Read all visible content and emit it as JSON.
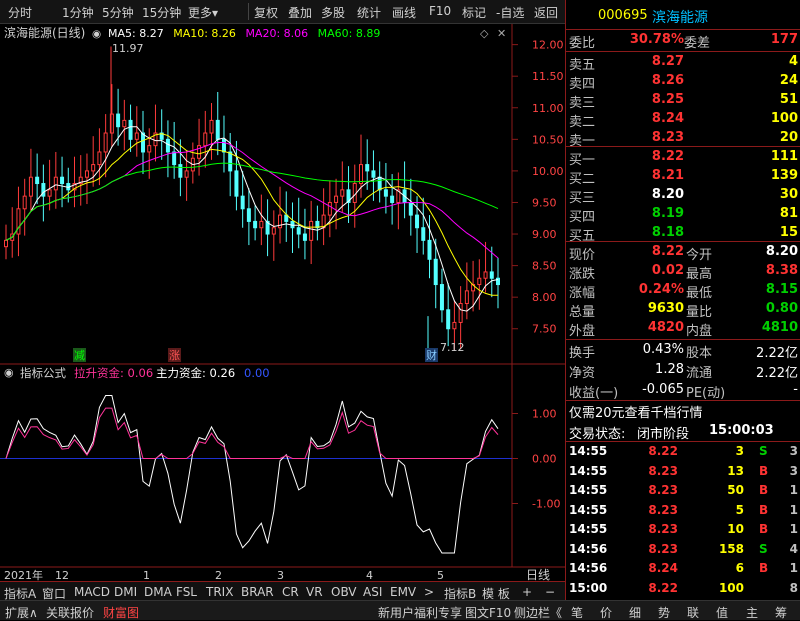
{
  "toolbar": {
    "left": [
      "分时",
      "1分钟",
      "5分钟",
      "15分钟",
      "更多"
    ],
    "more_arrow": "▾",
    "right": [
      "复权",
      "叠加",
      "多股",
      "统计",
      "画线",
      "F10",
      "标记",
      "-自选",
      "返回"
    ]
  },
  "chart": {
    "title": "滨海能源(日线)",
    "ma": [
      {
        "label": "MA5: 8.27",
        "color": "#ffffff"
      },
      {
        "label": "MA10: 8.26",
        "color": "#ffff00"
      },
      {
        "label": "MA20: 8.06",
        "color": "#ff00ff"
      },
      {
        "label": "MA60: 8.89",
        "color": "#00ff00"
      }
    ],
    "high_label": "11.97",
    "low_label": "7.12",
    "markers": {
      "jian": "减",
      "zhang": "涨",
      "cai": "财"
    },
    "ytick_labels": [
      "12.00",
      "11.50",
      "11.00",
      "10.50",
      "10.00",
      "9.50",
      "9.00",
      "8.50",
      "8.00",
      "7.50"
    ],
    "indicator": {
      "title": "指标公式",
      "s1": "拉升资金: 0.06",
      "s2": "主力资金: 0.26",
      "s3": "0.00",
      "ytick_labels": [
        "1.00",
        "0.00",
        "-1.00"
      ]
    },
    "date_labels": {
      "year": "2021年",
      "dec": "12",
      "jan": "1",
      "feb": "2",
      "mar": "3",
      "apr": "4",
      "may": "5"
    },
    "right_tab": "日线"
  },
  "chart_data": {
    "type": "candlestick",
    "title": "滨海能源(日线)",
    "ylim": [
      7.1,
      12.2
    ],
    "series": [
      {
        "name": "MA5",
        "color": "#ffffff"
      },
      {
        "name": "MA10",
        "color": "#ffff00"
      },
      {
        "name": "MA20",
        "color": "#ff00ff"
      },
      {
        "name": "MA60",
        "color": "#00ff00"
      }
    ],
    "close": [
      8.9,
      9.0,
      9.4,
      9.6,
      9.9,
      9.8,
      9.6,
      9.7,
      9.9,
      9.8,
      9.7,
      9.8,
      9.9,
      10.0,
      10.1,
      10.3,
      10.6,
      10.9,
      10.7,
      10.8,
      10.5,
      10.6,
      10.3,
      10.4,
      10.6,
      10.5,
      10.3,
      10.1,
      9.9,
      10.0,
      10.2,
      10.4,
      10.6,
      10.8,
      10.5,
      10.3,
      10.0,
      9.6,
      9.4,
      9.2,
      9.1,
      9.2,
      9.0,
      9.1,
      9.3,
      9.2,
      9.1,
      9.0,
      8.9,
      9.2,
      9.1,
      9.3,
      9.5,
      9.6,
      9.7,
      9.5,
      9.8,
      10.1,
      10.0,
      9.9,
      9.7,
      9.6,
      9.5,
      9.7,
      9.5,
      9.3,
      9.1,
      8.9,
      8.6,
      8.2,
      7.8,
      7.5,
      7.6,
      7.9,
      8.1,
      8.2,
      8.3,
      8.4,
      8.3,
      8.2
    ],
    "indicator": {
      "series": [
        {
          "name": "拉升资金",
          "last": 0.06
        },
        {
          "name": "主力资金",
          "last": 0.26
        }
      ],
      "ylim": [
        -2.3,
        1.7
      ]
    }
  },
  "quote": {
    "code": "000695",
    "name": "滨海能源",
    "weibi_label": "委比",
    "weibi": "30.78%",
    "weicha_label": "委差",
    "weicha": "177",
    "asks": [
      {
        "label": "卖五",
        "price": "8.27",
        "vol": "4"
      },
      {
        "label": "卖四",
        "price": "8.26",
        "vol": "24"
      },
      {
        "label": "卖三",
        "price": "8.25",
        "vol": "51"
      },
      {
        "label": "卖二",
        "price": "8.24",
        "vol": "100"
      },
      {
        "label": "卖一",
        "price": "8.23",
        "vol": "20"
      }
    ],
    "bids": [
      {
        "label": "买一",
        "price": "8.22",
        "vol": "111",
        "pc": "red"
      },
      {
        "label": "买二",
        "price": "8.21",
        "vol": "139",
        "pc": "red"
      },
      {
        "label": "买三",
        "price": "8.20",
        "vol": "30",
        "pc": "white"
      },
      {
        "label": "买四",
        "price": "8.19",
        "vol": "81",
        "pc": "green"
      },
      {
        "label": "买五",
        "price": "8.18",
        "vol": "15",
        "pc": "green"
      }
    ],
    "stats": [
      {
        "l1": "现价",
        "v1": "8.22",
        "c1": "red",
        "l2": "今开",
        "v2": "8.20",
        "c2": "white"
      },
      {
        "l1": "涨跌",
        "v1": "0.02",
        "c1": "red",
        "l2": "最高",
        "v2": "8.38",
        "c2": "red"
      },
      {
        "l1": "涨幅",
        "v1": "0.24%",
        "c1": "red",
        "l2": "最低",
        "v2": "8.15",
        "c2": "green"
      },
      {
        "l1": "总量",
        "v1": "9630",
        "c1": "yellow",
        "l2": "量比",
        "v2": "0.80",
        "c2": "green"
      },
      {
        "l1": "外盘",
        "v1": "4820",
        "c1": "red",
        "l2": "内盘",
        "v2": "4810",
        "c2": "green"
      }
    ],
    "fund": [
      {
        "l1": "换手",
        "v1": "0.43%",
        "l2": "股本",
        "v2": "2.22亿"
      },
      {
        "l1": "净资",
        "v1": "1.28",
        "l2": "流通",
        "v2": "2.22亿"
      },
      {
        "l1": "收益(一)",
        "v1": "-0.065",
        "l2": "PE(动)",
        "v2": "-"
      }
    ],
    "promo": "仅需20元查看千档行情",
    "status_label": "交易状态:",
    "status": "闭市阶段",
    "status_time": "15:00:03",
    "ticks": [
      {
        "t": "14:55",
        "p": "8.22",
        "v": "3",
        "d": "S",
        "n": "3",
        "dc": "green",
        "vc": "yellow"
      },
      {
        "t": "14:55",
        "p": "8.23",
        "v": "13",
        "d": "B",
        "n": "3",
        "dc": "red",
        "vc": "yellow"
      },
      {
        "t": "14:55",
        "p": "8.23",
        "v": "50",
        "d": "B",
        "n": "1",
        "dc": "red",
        "vc": "yellow"
      },
      {
        "t": "14:55",
        "p": "8.23",
        "v": "5",
        "d": "B",
        "n": "1",
        "dc": "red",
        "vc": "yellow"
      },
      {
        "t": "14:55",
        "p": "8.23",
        "v": "10",
        "d": "B",
        "n": "1",
        "dc": "red",
        "vc": "yellow"
      },
      {
        "t": "14:56",
        "p": "8.23",
        "v": "158",
        "d": "S",
        "n": "4",
        "dc": "green",
        "vc": "yellow"
      },
      {
        "t": "14:56",
        "p": "8.24",
        "v": "6",
        "d": "B",
        "n": "1",
        "dc": "red",
        "vc": "yellow"
      },
      {
        "t": "15:00",
        "p": "8.22",
        "v": "100",
        "d": "",
        "n": "8",
        "dc": "white",
        "vc": "yellow"
      }
    ]
  },
  "indicator_tabs": [
    "指标A",
    "窗口",
    "MACD",
    "DMI",
    "DMA",
    "FSL",
    "TRIX",
    "BRAR",
    "CR",
    "VR",
    "OBV",
    "ASI",
    "EMV"
  ],
  "indicator_tabs_more": ">",
  "indicator_tabs_right": [
    "指标B",
    "模 板",
    "+",
    "−"
  ],
  "bottom": {
    "left": [
      "扩展∧",
      "关联报价",
      "财富图"
    ],
    "mid": [
      "新用户福利专享",
      "图文F10",
      "侧边栏《"
    ],
    "right": [
      "笔",
      "价",
      "细",
      "势",
      "联",
      "值",
      "主",
      "筹"
    ]
  }
}
